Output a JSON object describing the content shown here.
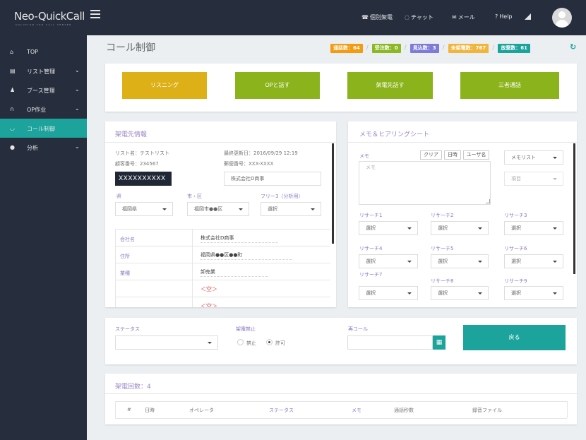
{
  "topbar": {
    "logo": "Neo-QuickCall",
    "logo_sub": "SOLUTION FOR CALL CENTER",
    "nav": [
      "個別架電",
      "チャット",
      "メール",
      "Help"
    ]
  },
  "sidebar": {
    "items": [
      {
        "label": "TOP"
      },
      {
        "label": "リスト管理"
      },
      {
        "label": "ブース管理"
      },
      {
        "label": "OP作业"
      },
      {
        "label": "コール制御"
      },
      {
        "label": "分析"
      }
    ]
  },
  "page": {
    "title": "コール制御",
    "stats": [
      {
        "label": "通話数：64",
        "color": "#f39c12"
      },
      {
        "label": "受注数：0",
        "color": "#8bb823"
      },
      {
        "label": "見込数：3",
        "color": "#7f7cd8"
      },
      {
        "label": "未架電数：767",
        "color": "#f1b43c"
      },
      {
        "label": "放棄数：61",
        "color": "#1ba39c"
      }
    ]
  },
  "actions": {
    "listening": "リスニング",
    "talk_op": "OPと話す",
    "talk_callee": "架電先話す",
    "three_way": "三者通話"
  },
  "callee": {
    "title": "架電先情報",
    "list_name": "リスト名：テストリスト",
    "last_updated": "最終更新日：2016/09/29 12:19",
    "customer_no": "顧客番号：234567",
    "postal": "郵便番号：XXX-XXXX",
    "phone": "XXXXXXXXXX",
    "company_input": "株式会社D商事",
    "pref_label": "県",
    "city_label": "市・区",
    "free_label": "フリー3（分析用）",
    "pref_value": "福岡県",
    "city_value": "福岡市●●区",
    "free_value": "選択",
    "rows": [
      {
        "key": "会社名",
        "value": "株式会社D商事"
      },
      {
        "key": "住所",
        "value": "福岡県●●区●●町"
      },
      {
        "key": "業種",
        "value": "卸売業"
      },
      {
        "key": "",
        "value": "＜空＞"
      },
      {
        "key": "",
        "value": "＜空＞"
      }
    ]
  },
  "memo": {
    "title": "メモ＆ヒアリングシート",
    "memo_label": "メモ",
    "memo_placeholder": "メモ",
    "clear": "クリア",
    "datetime": "日時",
    "user": "ユーザ名",
    "memo_list": "メモリスト",
    "item": "項目",
    "researches": [
      {
        "label": "リサーチ1",
        "value": "選択"
      },
      {
        "label": "リサーチ2",
        "value": "選択"
      },
      {
        "label": "リサーチ3",
        "value": "選択"
      },
      {
        "label": "リサーチ4",
        "value": "選択"
      },
      {
        "label": "リサーチ5",
        "value": "選択"
      },
      {
        "label": "リサーチ6",
        "value": "選択"
      },
      {
        "label": "リサーチ7",
        "value": "選択"
      },
      {
        "label": "リサーチ8",
        "value": "選択"
      },
      {
        "label": "リサーチ9",
        "value": "選択"
      }
    ]
  },
  "status": {
    "status_label": "ステータス",
    "ban_label": "架電禁止",
    "ban_off": "禁止",
    "ban_on": "許可",
    "recall_label": "再コール",
    "back": "戻る"
  },
  "history": {
    "title": "架電回数：4",
    "columns": [
      "#",
      "日時",
      "オペレータ",
      "ステータス",
      "メモ",
      "通話秒数",
      "録音ファイル"
    ]
  }
}
